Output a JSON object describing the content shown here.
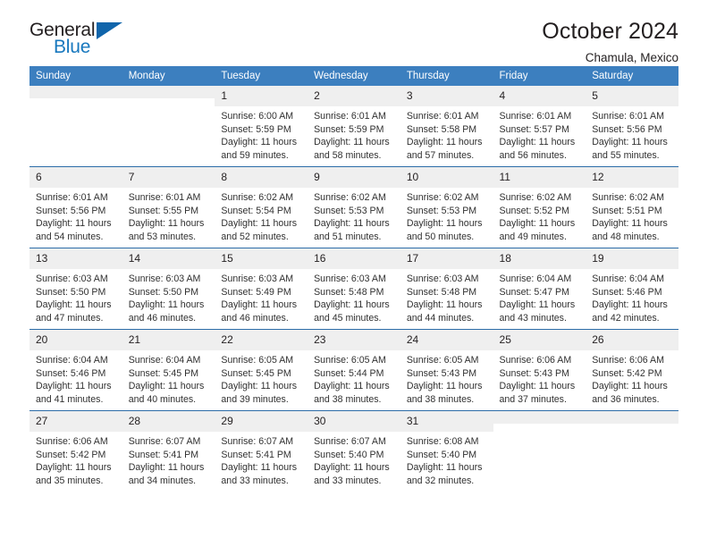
{
  "brand": {
    "name_dark": "General",
    "name_blue": "Blue",
    "accent_color": "#1065ab"
  },
  "header": {
    "title": "October 2024",
    "subtitle": "Chamula, Mexico"
  },
  "theme": {
    "header_bg": "#3c7fbf",
    "row_divider": "#2c6ca8",
    "daynum_bg": "#efefef",
    "cell_bg": "#ffffff",
    "text": "#231f20"
  },
  "weekday_headers": [
    "Sunday",
    "Monday",
    "Tuesday",
    "Wednesday",
    "Thursday",
    "Friday",
    "Saturday"
  ],
  "weeks": [
    [
      {
        "day": "",
        "blank": true,
        "sunrise": "",
        "sunset": "",
        "daylight_line1": "",
        "daylight_line2": ""
      },
      {
        "day": "",
        "blank": true,
        "sunrise": "",
        "sunset": "",
        "daylight_line1": "",
        "daylight_line2": ""
      },
      {
        "day": "1",
        "blank": false,
        "sunrise": "Sunrise: 6:00 AM",
        "sunset": "Sunset: 5:59 PM",
        "daylight_line1": "Daylight: 11 hours",
        "daylight_line2": "and 59 minutes."
      },
      {
        "day": "2",
        "blank": false,
        "sunrise": "Sunrise: 6:01 AM",
        "sunset": "Sunset: 5:59 PM",
        "daylight_line1": "Daylight: 11 hours",
        "daylight_line2": "and 58 minutes."
      },
      {
        "day": "3",
        "blank": false,
        "sunrise": "Sunrise: 6:01 AM",
        "sunset": "Sunset: 5:58 PM",
        "daylight_line1": "Daylight: 11 hours",
        "daylight_line2": "and 57 minutes."
      },
      {
        "day": "4",
        "blank": false,
        "sunrise": "Sunrise: 6:01 AM",
        "sunset": "Sunset: 5:57 PM",
        "daylight_line1": "Daylight: 11 hours",
        "daylight_line2": "and 56 minutes."
      },
      {
        "day": "5",
        "blank": false,
        "sunrise": "Sunrise: 6:01 AM",
        "sunset": "Sunset: 5:56 PM",
        "daylight_line1": "Daylight: 11 hours",
        "daylight_line2": "and 55 minutes."
      }
    ],
    [
      {
        "day": "6",
        "blank": false,
        "sunrise": "Sunrise: 6:01 AM",
        "sunset": "Sunset: 5:56 PM",
        "daylight_line1": "Daylight: 11 hours",
        "daylight_line2": "and 54 minutes."
      },
      {
        "day": "7",
        "blank": false,
        "sunrise": "Sunrise: 6:01 AM",
        "sunset": "Sunset: 5:55 PM",
        "daylight_line1": "Daylight: 11 hours",
        "daylight_line2": "and 53 minutes."
      },
      {
        "day": "8",
        "blank": false,
        "sunrise": "Sunrise: 6:02 AM",
        "sunset": "Sunset: 5:54 PM",
        "daylight_line1": "Daylight: 11 hours",
        "daylight_line2": "and 52 minutes."
      },
      {
        "day": "9",
        "blank": false,
        "sunrise": "Sunrise: 6:02 AM",
        "sunset": "Sunset: 5:53 PM",
        "daylight_line1": "Daylight: 11 hours",
        "daylight_line2": "and 51 minutes."
      },
      {
        "day": "10",
        "blank": false,
        "sunrise": "Sunrise: 6:02 AM",
        "sunset": "Sunset: 5:53 PM",
        "daylight_line1": "Daylight: 11 hours",
        "daylight_line2": "and 50 minutes."
      },
      {
        "day": "11",
        "blank": false,
        "sunrise": "Sunrise: 6:02 AM",
        "sunset": "Sunset: 5:52 PM",
        "daylight_line1": "Daylight: 11 hours",
        "daylight_line2": "and 49 minutes."
      },
      {
        "day": "12",
        "blank": false,
        "sunrise": "Sunrise: 6:02 AM",
        "sunset": "Sunset: 5:51 PM",
        "daylight_line1": "Daylight: 11 hours",
        "daylight_line2": "and 48 minutes."
      }
    ],
    [
      {
        "day": "13",
        "blank": false,
        "sunrise": "Sunrise: 6:03 AM",
        "sunset": "Sunset: 5:50 PM",
        "daylight_line1": "Daylight: 11 hours",
        "daylight_line2": "and 47 minutes."
      },
      {
        "day": "14",
        "blank": false,
        "sunrise": "Sunrise: 6:03 AM",
        "sunset": "Sunset: 5:50 PM",
        "daylight_line1": "Daylight: 11 hours",
        "daylight_line2": "and 46 minutes."
      },
      {
        "day": "15",
        "blank": false,
        "sunrise": "Sunrise: 6:03 AM",
        "sunset": "Sunset: 5:49 PM",
        "daylight_line1": "Daylight: 11 hours",
        "daylight_line2": "and 46 minutes."
      },
      {
        "day": "16",
        "blank": false,
        "sunrise": "Sunrise: 6:03 AM",
        "sunset": "Sunset: 5:48 PM",
        "daylight_line1": "Daylight: 11 hours",
        "daylight_line2": "and 45 minutes."
      },
      {
        "day": "17",
        "blank": false,
        "sunrise": "Sunrise: 6:03 AM",
        "sunset": "Sunset: 5:48 PM",
        "daylight_line1": "Daylight: 11 hours",
        "daylight_line2": "and 44 minutes."
      },
      {
        "day": "18",
        "blank": false,
        "sunrise": "Sunrise: 6:04 AM",
        "sunset": "Sunset: 5:47 PM",
        "daylight_line1": "Daylight: 11 hours",
        "daylight_line2": "and 43 minutes."
      },
      {
        "day": "19",
        "blank": false,
        "sunrise": "Sunrise: 6:04 AM",
        "sunset": "Sunset: 5:46 PM",
        "daylight_line1": "Daylight: 11 hours",
        "daylight_line2": "and 42 minutes."
      }
    ],
    [
      {
        "day": "20",
        "blank": false,
        "sunrise": "Sunrise: 6:04 AM",
        "sunset": "Sunset: 5:46 PM",
        "daylight_line1": "Daylight: 11 hours",
        "daylight_line2": "and 41 minutes."
      },
      {
        "day": "21",
        "blank": false,
        "sunrise": "Sunrise: 6:04 AM",
        "sunset": "Sunset: 5:45 PM",
        "daylight_line1": "Daylight: 11 hours",
        "daylight_line2": "and 40 minutes."
      },
      {
        "day": "22",
        "blank": false,
        "sunrise": "Sunrise: 6:05 AM",
        "sunset": "Sunset: 5:45 PM",
        "daylight_line1": "Daylight: 11 hours",
        "daylight_line2": "and 39 minutes."
      },
      {
        "day": "23",
        "blank": false,
        "sunrise": "Sunrise: 6:05 AM",
        "sunset": "Sunset: 5:44 PM",
        "daylight_line1": "Daylight: 11 hours",
        "daylight_line2": "and 38 minutes."
      },
      {
        "day": "24",
        "blank": false,
        "sunrise": "Sunrise: 6:05 AM",
        "sunset": "Sunset: 5:43 PM",
        "daylight_line1": "Daylight: 11 hours",
        "daylight_line2": "and 38 minutes."
      },
      {
        "day": "25",
        "blank": false,
        "sunrise": "Sunrise: 6:06 AM",
        "sunset": "Sunset: 5:43 PM",
        "daylight_line1": "Daylight: 11 hours",
        "daylight_line2": "and 37 minutes."
      },
      {
        "day": "26",
        "blank": false,
        "sunrise": "Sunrise: 6:06 AM",
        "sunset": "Sunset: 5:42 PM",
        "daylight_line1": "Daylight: 11 hours",
        "daylight_line2": "and 36 minutes."
      }
    ],
    [
      {
        "day": "27",
        "blank": false,
        "sunrise": "Sunrise: 6:06 AM",
        "sunset": "Sunset: 5:42 PM",
        "daylight_line1": "Daylight: 11 hours",
        "daylight_line2": "and 35 minutes."
      },
      {
        "day": "28",
        "blank": false,
        "sunrise": "Sunrise: 6:07 AM",
        "sunset": "Sunset: 5:41 PM",
        "daylight_line1": "Daylight: 11 hours",
        "daylight_line2": "and 34 minutes."
      },
      {
        "day": "29",
        "blank": false,
        "sunrise": "Sunrise: 6:07 AM",
        "sunset": "Sunset: 5:41 PM",
        "daylight_line1": "Daylight: 11 hours",
        "daylight_line2": "and 33 minutes."
      },
      {
        "day": "30",
        "blank": false,
        "sunrise": "Sunrise: 6:07 AM",
        "sunset": "Sunset: 5:40 PM",
        "daylight_line1": "Daylight: 11 hours",
        "daylight_line2": "and 33 minutes."
      },
      {
        "day": "31",
        "blank": false,
        "sunrise": "Sunrise: 6:08 AM",
        "sunset": "Sunset: 5:40 PM",
        "daylight_line1": "Daylight: 11 hours",
        "daylight_line2": "and 32 minutes."
      },
      {
        "day": "",
        "blank": true,
        "sunrise": "",
        "sunset": "",
        "daylight_line1": "",
        "daylight_line2": ""
      },
      {
        "day": "",
        "blank": true,
        "sunrise": "",
        "sunset": "",
        "daylight_line1": "",
        "daylight_line2": ""
      }
    ]
  ]
}
